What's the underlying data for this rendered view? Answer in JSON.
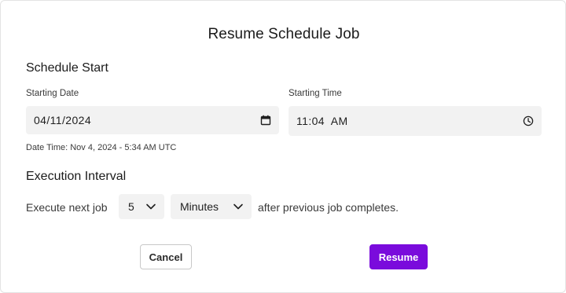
{
  "dialog": {
    "title": "Resume Schedule Job"
  },
  "schedule_start": {
    "heading": "Schedule Start",
    "date_label": "Starting Date",
    "date_value": "04/11/2024",
    "date_icon": "calendar-icon",
    "time_label": "Starting Time",
    "time_value": "11:04  AM",
    "time_icon": "clock-icon",
    "helper_text": "Date Time: Nov 4, 2024 - 5:34 AM UTC"
  },
  "execution_interval": {
    "heading": "Execution Interval",
    "prefix_text": "Execute next job",
    "count_value": "5",
    "unit_value": "Minutes",
    "suffix_text": "after previous job completes.",
    "chevron_icon": "chevron-down-icon"
  },
  "actions": {
    "cancel_label": "Cancel",
    "resume_label": "Resume",
    "resume_color": "#7a0bdc"
  }
}
